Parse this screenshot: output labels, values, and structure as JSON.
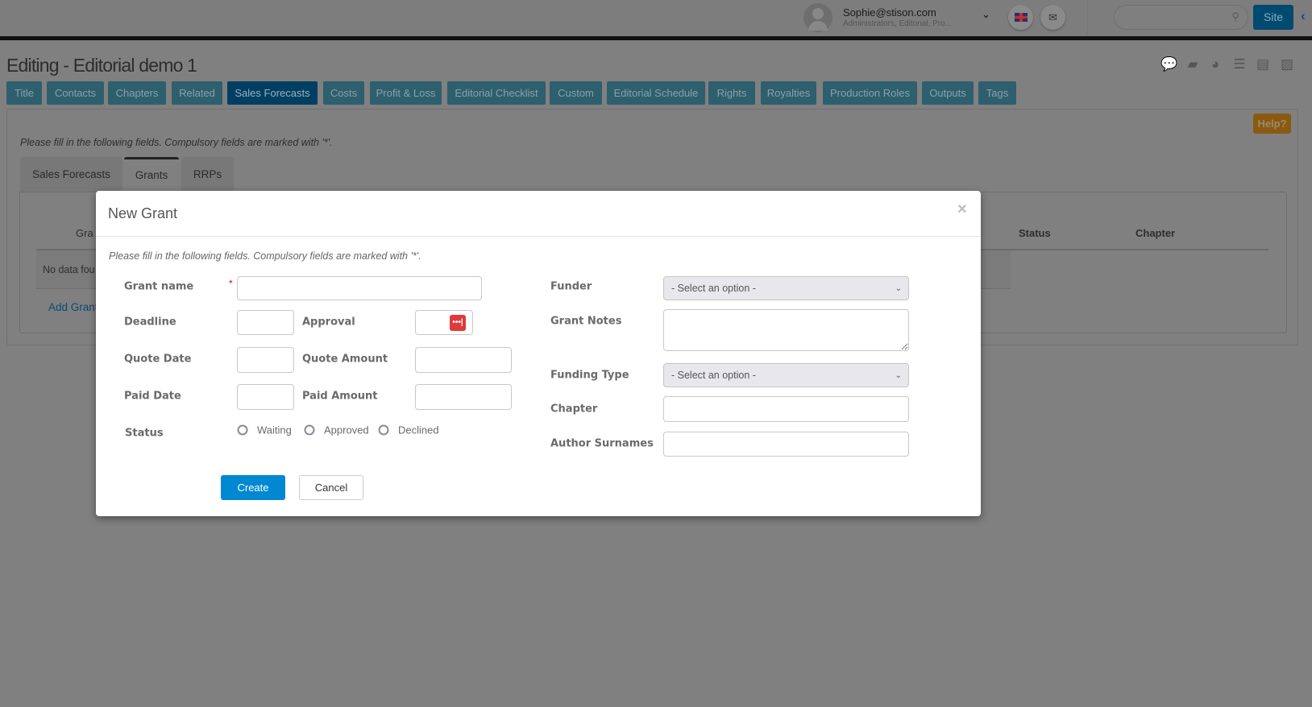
{
  "user": {
    "email": "Sophie@stison.com",
    "roles": "Administrators, Editorial, Pro..."
  },
  "header": {
    "site_label": "Site",
    "search_placeholder": ""
  },
  "page": {
    "title": "Editing - Editorial demo 1",
    "help_label": "Help?",
    "instructions": "Please fill in the following fields. Compulsory fields are marked with '*'."
  },
  "nav_tabs": [
    {
      "label": "Title"
    },
    {
      "label": "Contacts"
    },
    {
      "label": "Chapters"
    },
    {
      "label": "Related"
    },
    {
      "label": "Sales Forecasts",
      "active": true
    },
    {
      "label": "Costs"
    },
    {
      "label": "Profit & Loss"
    },
    {
      "label": "Editorial Checklist"
    },
    {
      "label": "Custom"
    },
    {
      "label": "Editorial Schedule"
    },
    {
      "label": "Rights"
    },
    {
      "label": "Royalties"
    },
    {
      "label": "Production Roles"
    },
    {
      "label": "Outputs"
    },
    {
      "label": "Tags"
    }
  ],
  "sub_tabs": [
    {
      "label": "Sales Forecasts"
    },
    {
      "label": "Grants",
      "active": true
    },
    {
      "label": "RRPs"
    }
  ],
  "table": {
    "columns": [
      "Gra",
      "Status",
      "Chapter"
    ],
    "empty_text": "No data fou",
    "add_link": "Add Grant"
  },
  "modal": {
    "title": "New Grant",
    "close": "×",
    "instructions": "Please fill in the following fields. Compulsory fields are marked with '*'.",
    "required_mark": "*",
    "fields": {
      "grant_name": {
        "label": "Grant name",
        "value": ""
      },
      "deadline": {
        "label": "Deadline",
        "value": ""
      },
      "approval": {
        "label": "Approval",
        "value": ""
      },
      "quote_date": {
        "label": "Quote Date",
        "value": ""
      },
      "quote_amount": {
        "label": "Quote Amount",
        "value": ""
      },
      "paid_date": {
        "label": "Paid Date",
        "value": ""
      },
      "paid_amount": {
        "label": "Paid Amount",
        "value": ""
      },
      "status": {
        "label": "Status",
        "options": [
          "Waiting",
          "Approved",
          "Declined"
        ],
        "selected": null
      },
      "funder": {
        "label": "Funder",
        "value": "- Select an option -"
      },
      "grant_notes": {
        "label": "Grant Notes",
        "value": ""
      },
      "funding_type": {
        "label": "Funding Type",
        "value": "- Select an option -"
      },
      "chapter": {
        "label": "Chapter",
        "value": ""
      },
      "author_surnames": {
        "label": "Author Surnames",
        "value": ""
      }
    },
    "create_label": "Create",
    "cancel_label": "Cancel"
  },
  "colors": {
    "tab": "#2e5f6e",
    "tab_active": "#003f62",
    "create": "#0288d1",
    "help": "#8a5a10",
    "approval_icon": "#e03a3a"
  }
}
